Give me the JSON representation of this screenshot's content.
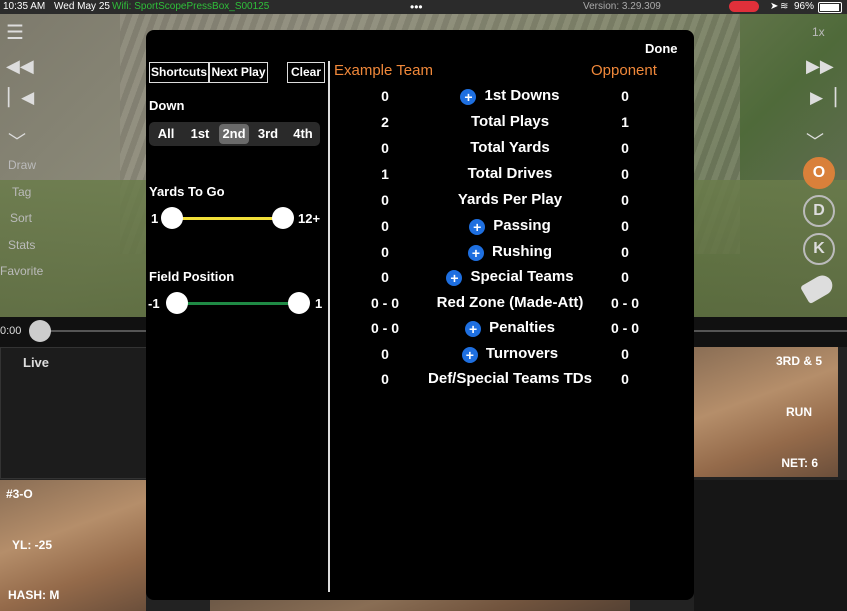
{
  "status_bar": {
    "time": "10:35 AM",
    "date": "Wed May 25",
    "wifi": "Wifi: SportScopePressBox_S00125",
    "version": "Version: 3.29.309",
    "battery": "96%",
    "dots": "•••"
  },
  "left_rail": {
    "items": [
      "Draw",
      "Tag",
      "Sort",
      "Stats",
      "Favorite"
    ]
  },
  "right_rail": {
    "speed": "1x",
    "buttons": [
      "O",
      "D",
      "K"
    ]
  },
  "timeline": {
    "time": "0:00"
  },
  "thumbnails": {
    "live_label": "Live",
    "right_down": "3RD & 5",
    "right_type": "RUN",
    "right_net": "NET: 6",
    "left_play": "#3-O",
    "left_yl": "YL: -25",
    "left_hash": "HASH: M"
  },
  "modal": {
    "done": "Done",
    "shortcuts": "Shortcuts",
    "next_play": "Next Play",
    "clear": "Clear",
    "down_label": "Down",
    "down_options": [
      "All",
      "1st",
      "2nd",
      "3rd",
      "4th"
    ],
    "down_selected": "2nd",
    "ytg_label": "Yards To Go",
    "ytg_min": "1",
    "ytg_max": "12+",
    "fp_label": "Field Position",
    "fp_min": "-1",
    "fp_max": "1",
    "team": "Example Team",
    "opponent": "Opponent",
    "stats": [
      {
        "label": "1st Downs",
        "team": "0",
        "opp": "0",
        "expandable": true
      },
      {
        "label": "Total Plays",
        "team": "2",
        "opp": "1",
        "expandable": false
      },
      {
        "label": "Total Yards",
        "team": "0",
        "opp": "0",
        "expandable": false
      },
      {
        "label": "Total Drives",
        "team": "1",
        "opp": "0",
        "expandable": false
      },
      {
        "label": "Yards Per Play",
        "team": "0",
        "opp": "0",
        "expandable": false
      },
      {
        "label": "Passing",
        "team": "0",
        "opp": "0",
        "expandable": true
      },
      {
        "label": "Rushing",
        "team": "0",
        "opp": "0",
        "expandable": true
      },
      {
        "label": "Special Teams",
        "team": "0",
        "opp": "0",
        "expandable": true
      },
      {
        "label": "Red Zone (Made-Att)",
        "team": "0 - 0",
        "opp": "0 - 0",
        "expandable": false
      },
      {
        "label": "Penalties",
        "team": "0 - 0",
        "opp": "0 - 0",
        "expandable": true
      },
      {
        "label": "Turnovers",
        "team": "0",
        "opp": "0",
        "expandable": true
      },
      {
        "label": "Def/Special Teams TDs",
        "team": "0",
        "opp": "0",
        "expandable": false
      }
    ]
  },
  "colors": {
    "accent_orange": "#f0883a",
    "plus_blue": "#1e6fe0",
    "ytg_track": "#f2e03a",
    "fp_track": "#1f8a45"
  }
}
